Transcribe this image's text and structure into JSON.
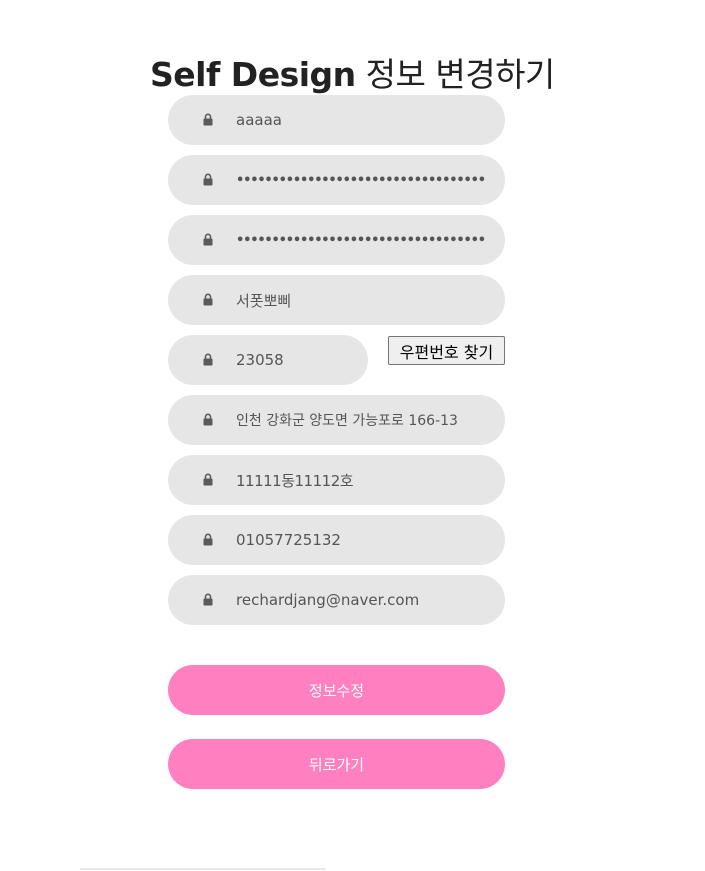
{
  "title": {
    "en": "Self Design",
    "ko": " 정보 변경하기"
  },
  "icons": {
    "field_icon": "lock-icon"
  },
  "colors": {
    "field_bg": "#e6e6e6",
    "button_pink": "#ff80c0",
    "button_text": "#ffffff"
  },
  "fields": {
    "user_id": "aaaaa",
    "password": "••••••••••••••••••••••••••••••••••••••",
    "password_confirm": "••••••••••••••••••••••••••••••••••••••",
    "name": "서폿뽀삐",
    "zipcode": "23058",
    "address": "인천 강화군 양도면 가능포로 166-13",
    "address_detail": "11111동11112호",
    "phone": "01057725132",
    "email": "rechardjang@naver.com"
  },
  "buttons": {
    "find_zip": "우편번호 찾기",
    "submit": "정보수정",
    "back": "뒤로가기"
  }
}
